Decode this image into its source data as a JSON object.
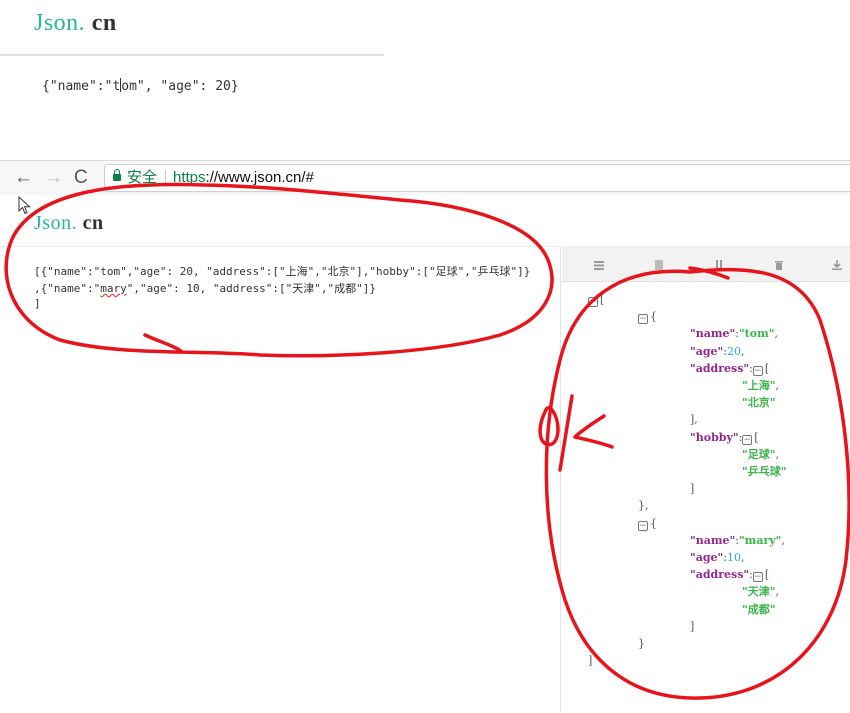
{
  "top_snippet": {
    "logo_j": "J",
    "logo_son": "son.",
    "logo_cn": "cn",
    "json_before_caret": "{\"name\":\"t",
    "json_after_caret": "om\", \"age\": 20}"
  },
  "browser": {
    "back_icon": "←",
    "forward_icon": "→",
    "reload_icon": "C",
    "secure_label": "安全",
    "url_scheme": "https",
    "url_rest": "://www.json.cn/#"
  },
  "page": {
    "logo_j": "J",
    "logo_son": "son.",
    "logo_cn": "cn",
    "source_line_1": "[{\"name\":\"tom\",\"age\": 20, \"address\":[\"上海\",\"北京\"],\"hobby\":[\"足球\",\"乒乓球\"]}",
    "source_line_2_a": ",{\"name\":\"",
    "source_line_2_b": "mary",
    "source_line_2_c": "\",\"age\": 10, \"address\":[\"天津\",\"成都\"]}",
    "source_line_3": "]"
  },
  "viewer": {
    "toolbar_icons": [
      "format-icon",
      "compress-icon",
      "sort-icon",
      "delete-icon",
      "download-icon"
    ],
    "tree": [
      {
        "indent": 0,
        "collapse": true,
        "text": "["
      },
      {
        "indent": 1,
        "collapse": true,
        "text": "{"
      },
      {
        "indent": 2,
        "key": "name",
        "str": "tom",
        "suffix": ","
      },
      {
        "indent": 2,
        "key": "age",
        "num": "20",
        "suffix": ","
      },
      {
        "indent": 2,
        "key": "address",
        "collapse": true,
        "text": "["
      },
      {
        "indent": 3,
        "str": "上海",
        "suffix": ","
      },
      {
        "indent": 3,
        "str": "北京"
      },
      {
        "indent": 2,
        "text": "],"
      },
      {
        "indent": 2,
        "key": "hobby",
        "collapse": true,
        "text": "["
      },
      {
        "indent": 3,
        "str": "足球",
        "suffix": ","
      },
      {
        "indent": 3,
        "str": "乒乓球"
      },
      {
        "indent": 2,
        "text": "]"
      },
      {
        "indent": 1,
        "text": "},"
      },
      {
        "indent": 1,
        "collapse": true,
        "text": "{"
      },
      {
        "indent": 2,
        "key": "name",
        "str": "mary",
        "suffix": ","
      },
      {
        "indent": 2,
        "key": "age",
        "num": "10",
        "suffix": ","
      },
      {
        "indent": 2,
        "key": "address",
        "collapse": true,
        "text": "["
      },
      {
        "indent": 3,
        "str": "天津",
        "suffix": ","
      },
      {
        "indent": 3,
        "str": "成都"
      },
      {
        "indent": 2,
        "text": "]"
      },
      {
        "indent": 1,
        "text": "}"
      },
      {
        "indent": 0,
        "text": "]"
      }
    ]
  },
  "colors": {
    "brand_teal": "#27b6a0",
    "secure_green": "#0b8043",
    "json_key": "#92278f",
    "json_string": "#3ab54a",
    "json_number": "#25aae1",
    "annotation_red": "#e8141b"
  },
  "annotations": {
    "handwritten_mark": "ok"
  }
}
